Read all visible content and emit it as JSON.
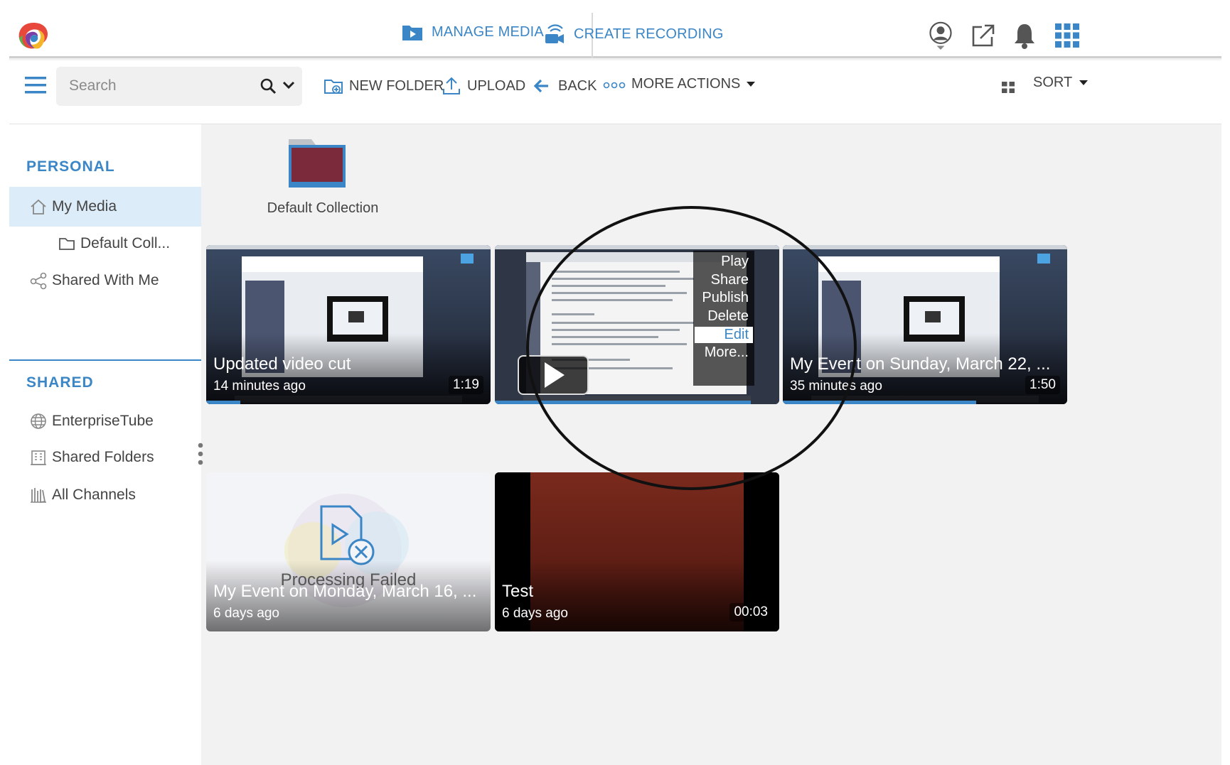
{
  "topnav": {
    "manage_media": "MANAGE MEDIA",
    "create_recording": "CREATE RECORDING"
  },
  "toolbar": {
    "search_placeholder": "Search",
    "new_folder": "NEW FOLDER",
    "upload": "UPLOAD",
    "back": "BACK",
    "more_actions": "MORE ACTIONS",
    "sort": "SORT"
  },
  "sidebar": {
    "personal_heading": "PERSONAL",
    "my_media": "My Media",
    "default_coll": "Default Coll...",
    "shared_with_me": "Shared With Me",
    "shared_heading": "SHARED",
    "enterprise_tube": "EnterpriseTube",
    "shared_folders": "Shared Folders",
    "all_channels": "All Channels"
  },
  "folder": {
    "label": "Default Collection"
  },
  "cards": [
    {
      "title": "Updated video cut",
      "time": "14 minutes ago",
      "duration": "1:19",
      "progress": 0.12
    },
    {
      "title": "",
      "time": "",
      "duration": "",
      "progress": 0.9
    },
    {
      "title": "My Event on Sunday, March 22, ...",
      "time": "35 minutes ago",
      "duration": "1:50",
      "progress": 0.68
    },
    {
      "title": "My Event on Monday, March 16, ...",
      "time": "6 days ago",
      "duration": "",
      "status": "Processing Failed"
    },
    {
      "title": "Test",
      "time": "6 days ago",
      "duration": "00:03"
    }
  ],
  "context_menu": [
    "Play",
    "Share",
    "Publish",
    "Delete",
    "Edit",
    "More..."
  ],
  "colors": {
    "accent": "#3b86c6",
    "sidebar_active": "#dcecf8"
  }
}
